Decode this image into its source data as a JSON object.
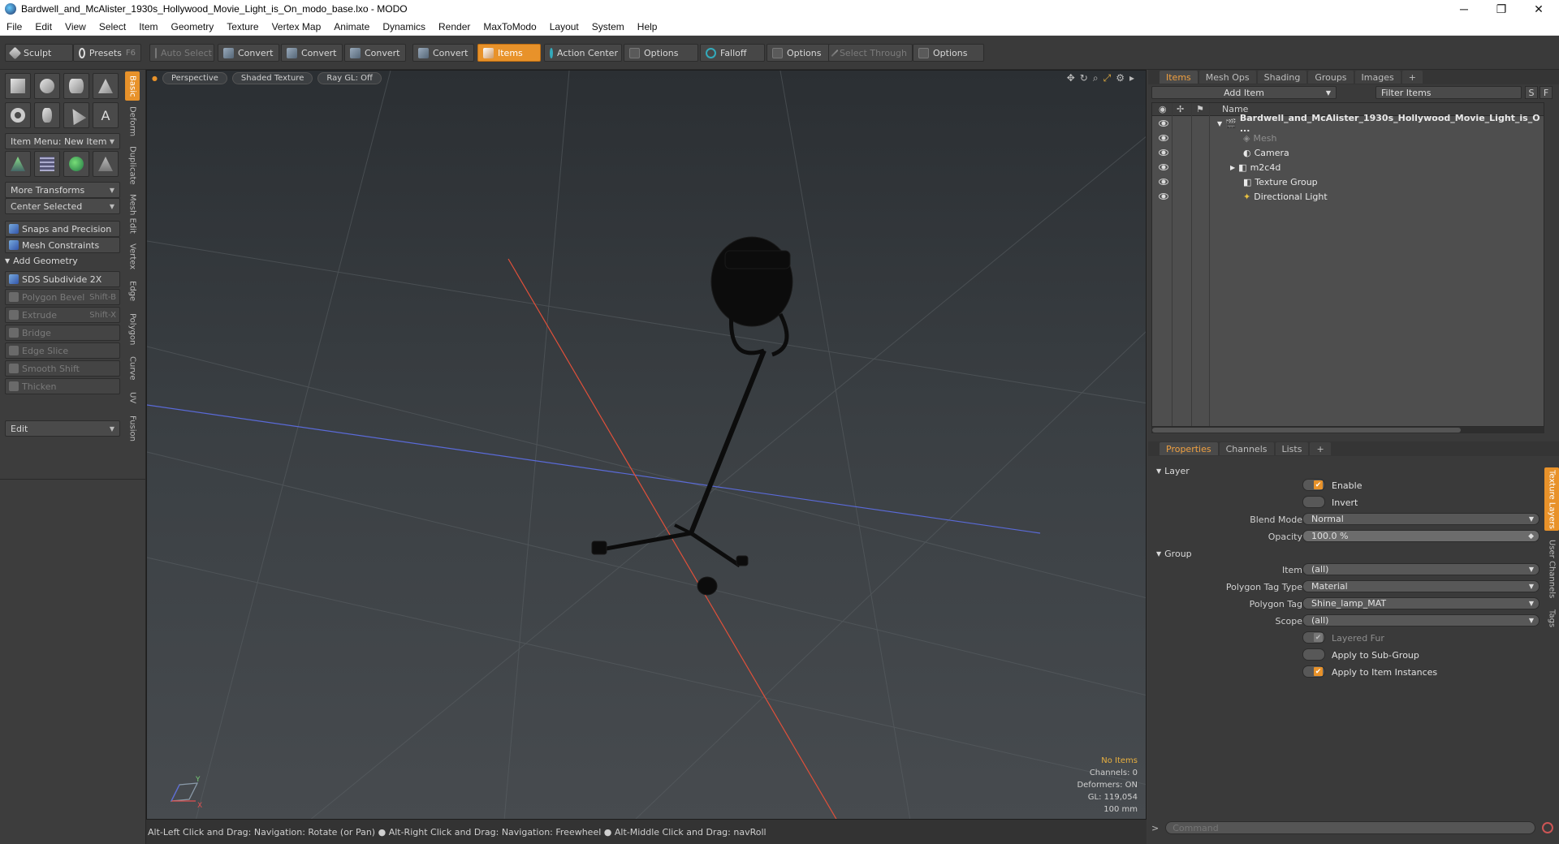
{
  "window": {
    "title": "Bardwell_and_McAlister_1930s_Hollywood_Movie_Light_is_On_modo_base.lxo - MODO",
    "min": "─",
    "max": "❐",
    "close": "✕"
  },
  "menu": [
    "File",
    "Edit",
    "View",
    "Select",
    "Item",
    "Geometry",
    "Texture",
    "Vertex Map",
    "Animate",
    "Dynamics",
    "Render",
    "MaxToModo",
    "Layout",
    "System",
    "Help"
  ],
  "toolbar": {
    "sculpt": "Sculpt",
    "presets": "Presets",
    "presets_key": "F6",
    "auto_select": "Auto Select",
    "convert1": "Convert",
    "convert2": "Convert",
    "convert3": "Convert",
    "convert4": "Convert",
    "items": "Items",
    "action_center": "Action Center",
    "options1": "Options",
    "falloff": "Falloff",
    "options2": "Options",
    "select_through": "Select Through",
    "options3": "Options"
  },
  "left": {
    "item_menu": "Item Menu: New Item",
    "more_transforms": "More Transforms",
    "center_selected": "Center Selected",
    "snaps": "Snaps and Precision",
    "mesh_constraints": "Mesh Constraints",
    "add_geometry": "Add Geometry",
    "sds": "SDS Subdivide 2X",
    "polygon_bevel": "Polygon Bevel",
    "polygon_bevel_key": "Shift-B",
    "extrude": "Extrude",
    "extrude_key": "Shift-X",
    "bridge": "Bridge",
    "edge_slice": "Edge Slice",
    "smooth_shift": "Smooth Shift",
    "thicken": "Thicken",
    "edit": "Edit",
    "tabs": [
      "Basic",
      "Deform",
      "Duplicate",
      "Mesh Edit",
      "Vertex",
      "Edge",
      "Polygon",
      "Curve",
      "UV",
      "Fusion"
    ]
  },
  "viewport": {
    "view": "Perspective",
    "shading": "Shaded Texture",
    "raygl": "Ray GL: Off",
    "stats": {
      "items": "No Items",
      "channels": "Channels: 0",
      "deformers": "Deformers: ON",
      "gl": "GL: 119,054",
      "size": "100 mm"
    },
    "axis_y": "Y",
    "axis_x": "X"
  },
  "status": {
    "text": "Alt-Left Click and Drag: Navigation: Rotate (or Pan) ● Alt-Right Click and Drag: Navigation: Freewheel ● Alt-Middle Click and Drag: navRoll"
  },
  "items_panel": {
    "tabs": [
      "Items",
      "Mesh Ops",
      "Shading",
      "Groups",
      "Images",
      "+"
    ],
    "add_item": "Add Item",
    "filter": "Filter Items",
    "s": "S",
    "f": "F",
    "col_name": "Name",
    "rows": [
      {
        "name": "Bardwell_and_McAlister_1930s_Hollywood_Movie_Light_is_O ..."
      },
      {
        "name": "Mesh"
      },
      {
        "name": "Camera"
      },
      {
        "name": "m2c4d"
      },
      {
        "name": "Texture Group"
      },
      {
        "name": "Directional Light"
      }
    ]
  },
  "props_panel": {
    "tabs": [
      "Properties",
      "Channels",
      "Lists",
      "+"
    ],
    "layer": "Layer",
    "enable": "Enable",
    "invert": "Invert",
    "blend_mode_label": "Blend Mode",
    "blend_mode": "Normal",
    "opacity_label": "Opacity",
    "opacity": "100.0 %",
    "group": "Group",
    "item_label": "Item",
    "item": "(all)",
    "ptt_label": "Polygon Tag Type",
    "ptt": "Material",
    "pt_label": "Polygon Tag",
    "pt": "Shine_lamp_MAT",
    "scope_label": "Scope",
    "scope": "(all)",
    "layered_fur": "Layered Fur",
    "apply_sub": "Apply to Sub-Group",
    "apply_inst": "Apply to Item Instances",
    "side_tabs": [
      "Texture Layers",
      "User Channels",
      "Tags"
    ]
  },
  "command": {
    "placeholder": "Command"
  },
  "colors": {
    "accent": "#e8922a",
    "x_axis": "#e0503a",
    "z_axis": "#5a6ad8"
  }
}
